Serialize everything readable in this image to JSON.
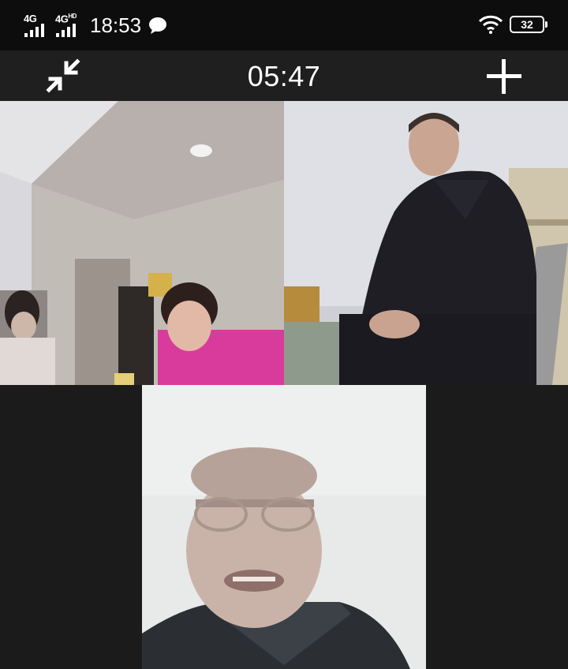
{
  "status_bar": {
    "network_1": "4G",
    "network_2": "4G",
    "network_2_suffix": "HD",
    "time": "18:53",
    "battery": "32",
    "icons": [
      "signal-bars-icon",
      "chat-bubble-icon",
      "wifi-icon",
      "battery-icon"
    ]
  },
  "call": {
    "duration": "05:47",
    "icons": [
      "minimize-arrows-icon",
      "add-participant-icon"
    ]
  },
  "participants": [
    {
      "tile": "video-tile-1"
    },
    {
      "tile": "video-tile-2"
    },
    {
      "tile": "video-tile-3"
    }
  ]
}
